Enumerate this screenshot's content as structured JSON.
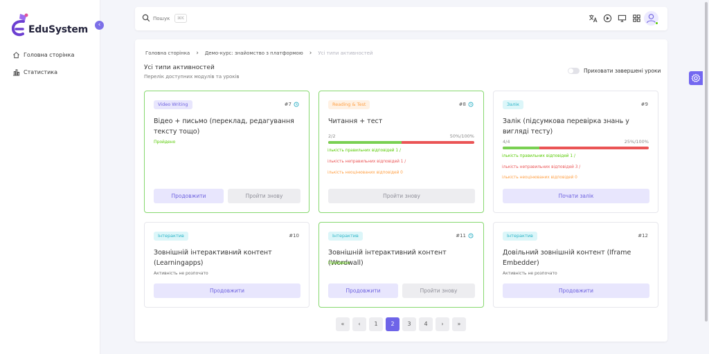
{
  "app": {
    "logo_text": "EduSystem"
  },
  "sidebar": {
    "items": [
      {
        "label": "Головна сторінка",
        "icon": "home-icon"
      },
      {
        "label": "Статистика",
        "icon": "chart-icon"
      }
    ]
  },
  "topbar": {
    "search_placeholder": "Пошук",
    "search_shortcut": "⌘K",
    "icons": [
      "translate-icon",
      "play-icon",
      "monitor-icon",
      "grid-icon",
      "user-avatar"
    ]
  },
  "breadcrumb": [
    "Головна сторінка",
    "Демо-курс: знайомство з платформою",
    "Усі типи активностей"
  ],
  "page": {
    "title": "Усі типи активностей",
    "subtitle": "Перелік доступних модулів та уроків",
    "toggle_label": "Приховати завершені уроки",
    "toggle_on": false
  },
  "cards": [
    {
      "badge": "Video Writing",
      "number": "#7",
      "title": "Відео + письмо (переклад, редагування тексту тощо)",
      "status": "Пройдено",
      "buttons": [
        "Продовжити",
        "Пройти знову"
      ]
    },
    {
      "badge": "Reading & Test",
      "number": "#8",
      "title": "Читання + тест",
      "progress_left": "2/2",
      "progress_right": "50%/100%",
      "progress_value": 0.5,
      "stats": [
        "ількість правильних відповідей 1 /",
        "ількість неправильних відповідей 1 /",
        "ількість неоцінюваних відповідей 0"
      ],
      "buttons": [
        "Пройти знову"
      ]
    },
    {
      "badge": "Залік",
      "number": "#9",
      "title": "Залік (підсумкова перевірка знань у вигляді тесту)",
      "progress_left": "4/4",
      "progress_right": "25%/100%",
      "progress_value": 0.25,
      "stats": [
        "ількість правильних відповідей 1 /",
        "ількість неправильних відповідей 3 /",
        "ількість неоцінюваних відповідей 0"
      ],
      "buttons": [
        "Почати залік"
      ]
    },
    {
      "badge": "Інтерактив",
      "number": "#10",
      "title": "Зовнішній інтерактивний контент (Learningapps)",
      "status": "Активність не розпочато",
      "buttons": [
        "Продовжити"
      ]
    },
    {
      "badge": "Інтерактив",
      "number": "#11",
      "title": "Зовнішній інтерактивний контент (Wordwall)",
      "status": "Пройдено",
      "buttons": [
        "Продовжити",
        "Пройти знову"
      ]
    },
    {
      "badge": "Інтерактив",
      "number": "#12",
      "title": "Довільний зовнішній контент (Iframe Embedder)",
      "status": "Активність не розпочато",
      "buttons": [
        "Продовжити"
      ]
    }
  ],
  "pagination": {
    "first": "«",
    "prev": "‹",
    "pages": [
      "1",
      "2",
      "3",
      "4"
    ],
    "current": "2",
    "next": "›",
    "last": "»"
  },
  "colors": {
    "accent": "#7367f0",
    "success": "#56ca00",
    "danger": "#ea5455",
    "warning": "#ff9f43"
  }
}
